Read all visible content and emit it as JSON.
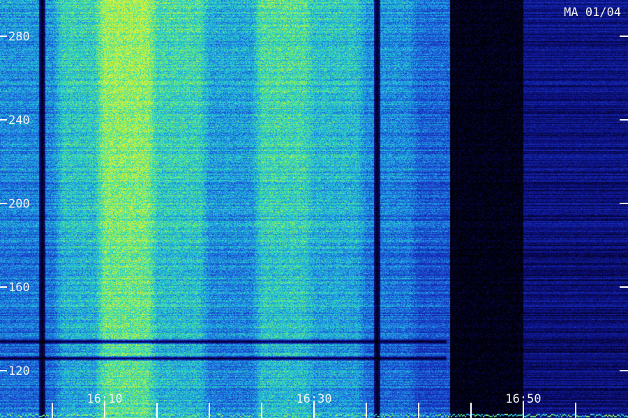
{
  "chart_data": {
    "type": "heatmap",
    "title": "",
    "station_label": "MA 01/04",
    "xlabel": "",
    "ylabel": "",
    "x_time_range_minutes": [
      16.0,
      16.97
    ],
    "x_time_range": [
      "16:03",
      "16:58"
    ],
    "x_tick_labels": [
      {
        "label": "16:10",
        "minute": 10
      },
      {
        "label": "16:30",
        "minute": 30
      },
      {
        "label": "16:50",
        "minute": 50
      }
    ],
    "x_minor_tick_minutes": [
      5,
      10,
      15,
      20,
      25,
      30,
      35,
      40,
      45,
      50,
      55
    ],
    "ylim": [
      106,
      298
    ],
    "y_tick_labels": [
      {
        "label": "120",
        "value": 120
      },
      {
        "label": "160",
        "value": 160
      },
      {
        "label": "200",
        "value": 200
      },
      {
        "label": "240",
        "value": 240
      },
      {
        "label": "280",
        "value": 280
      }
    ],
    "colormap": [
      "#000000",
      "#0a0a6e",
      "#1428b4",
      "#1e64dc",
      "#1eb4e6",
      "#32dcb4",
      "#78f064",
      "#dcf03c"
    ],
    "grid": false,
    "intensity_regions": [
      {
        "from": "16:03",
        "to": "16:06",
        "intensity": 0.42
      },
      {
        "from": "16:06",
        "to": "16:10",
        "intensity": 0.55
      },
      {
        "from": "16:10",
        "to": "16:15",
        "intensity": 0.75
      },
      {
        "from": "16:15",
        "to": "16:20",
        "intensity": 0.58
      },
      {
        "from": "16:20",
        "to": "16:25",
        "intensity": 0.46
      },
      {
        "from": "16:25",
        "to": "16:30",
        "intensity": 0.6
      },
      {
        "from": "16:30",
        "to": "16:35",
        "intensity": 0.52
      },
      {
        "from": "16:35",
        "to": "16:40",
        "intensity": 0.42
      },
      {
        "from": "16:40",
        "to": "16:43",
        "intensity": 0.35
      },
      {
        "from": "16:43",
        "to": "16:50",
        "intensity": 0.02
      },
      {
        "from": "16:50",
        "to": "16:58",
        "intensity": 0.15
      }
    ],
    "dark_time_gaps": [
      "16:04",
      "16:36"
    ],
    "dark_frequency_lines": [
      126,
      134
    ]
  }
}
